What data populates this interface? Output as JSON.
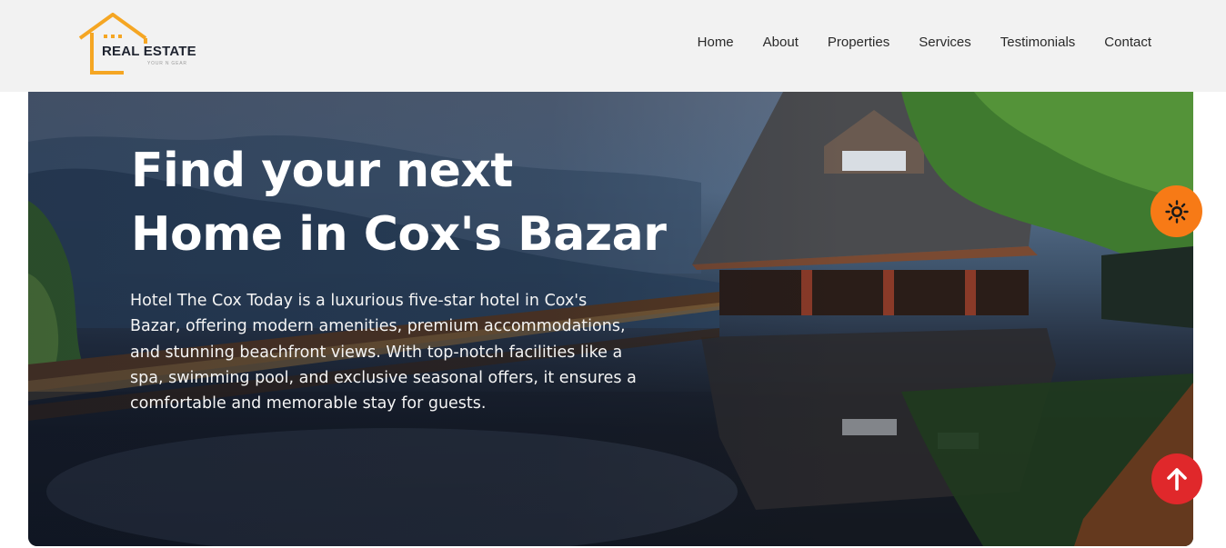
{
  "header": {
    "logo": {
      "name": "REAL ESTATE",
      "tagline": "YOUR N GEAR",
      "color": "#f5a623"
    },
    "nav": [
      {
        "label": "Home"
      },
      {
        "label": "About"
      },
      {
        "label": "Properties"
      },
      {
        "label": "Services"
      },
      {
        "label": "Testimonials"
      },
      {
        "label": "Contact"
      }
    ]
  },
  "hero": {
    "title_line1": "Find your next",
    "title_line2": "Home in Cox's Bazar",
    "description": "Hotel The Cox Today is a luxurious five-star hotel in Cox's Bazar, offering modern amenities, premium accommodations, and stunning beachfront views. With top-notch facilities like a spa, swimming pool, and exclusive seasonal offers, it ensures a comfortable and memorable stay for guests."
  },
  "floating_buttons": {
    "theme_toggle": {
      "icon": "sun-icon",
      "color": "#f77a16"
    },
    "scroll_top": {
      "icon": "arrow-up-icon",
      "color": "#e0282b"
    }
  }
}
